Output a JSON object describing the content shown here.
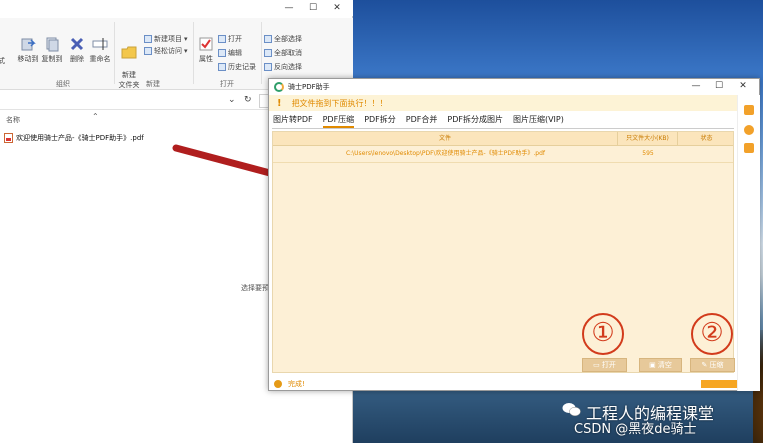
{
  "explorer": {
    "ribbon": {
      "labels": [
        "式",
        "移动到",
        "复制到",
        "删除",
        "重命名",
        "新建\n文件夹",
        "属性"
      ],
      "small": {
        "new_item": "新建项目",
        "easy_access": "轻松访问",
        "open": "打开",
        "edit": "编辑",
        "history": "历史记录",
        "select_all": "全部选择",
        "select_none": "全部取消",
        "invert": "反向选择"
      },
      "groups": [
        "组织",
        "新建",
        "打开"
      ]
    },
    "column_name": "名称",
    "file_name": "欢迎使用骑士产品-《骑士PDF助手》.pdf",
    "preview_hint": "选择要预"
  },
  "app": {
    "title": "骑士PDF助手",
    "notice": "把文件拖到下面执行！！！",
    "tabs": [
      "图片转PDF",
      "PDF压缩",
      "PDF拆分",
      "PDF合并",
      "PDF拆分成图片",
      "图片压缩(VIP)"
    ],
    "active_tab_index": 1,
    "table": {
      "headers": [
        "文件",
        "只文件大小(KB)",
        "状态"
      ],
      "rows": [
        {
          "file": "C:\\Users\\lenovo\\Desktop\\PDF\\欢迎使用骑士产品-《骑士PDF助手》.pdf",
          "size": "595",
          "status": ""
        }
      ]
    },
    "buttons": {
      "open": "打开",
      "clear": "清空",
      "compress": "压缩"
    },
    "annotations": {
      "one": "①",
      "two": "②"
    },
    "status": "完成!"
  },
  "watermark": {
    "line1": "工程人的编程课堂",
    "line2": "CSDN @黑夜de骑士"
  },
  "colors": {
    "accent": "#E08A00",
    "content_bg": "#FDF0D6",
    "annotation_red": "#D23B1C",
    "arrow_red": "#B01E1E"
  }
}
